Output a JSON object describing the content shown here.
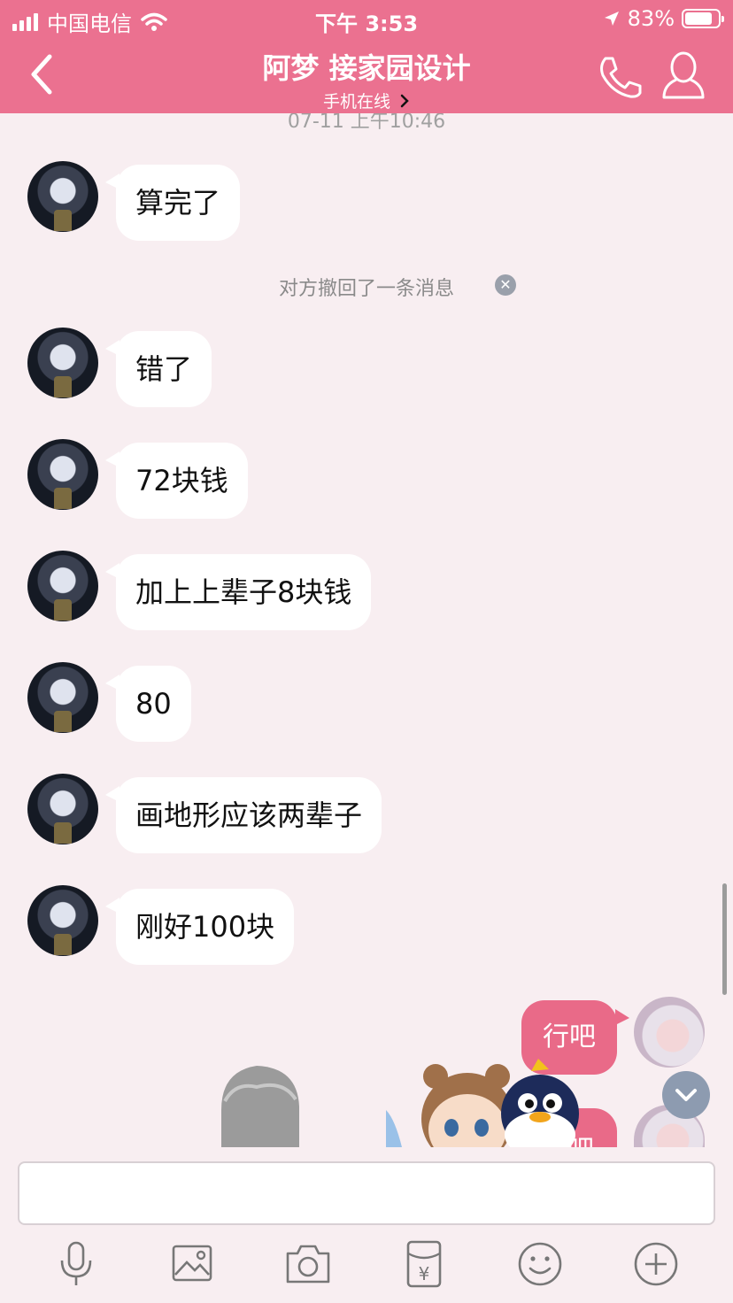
{
  "status_bar": {
    "carrier": "中国电信",
    "time": "下午 3:53",
    "battery": "83%",
    "battery_level": 0.83,
    "icons": [
      "signal-icon",
      "wifi-icon",
      "location-arrow-icon",
      "battery-icon"
    ]
  },
  "header": {
    "title": "阿梦 接家园设计",
    "subtitle": "手机在线",
    "icons": [
      "back-chevron-icon",
      "phone-icon",
      "profile-icon",
      "chevron-right-icon"
    ]
  },
  "chat": {
    "timestamp": "07-11 上午10:46",
    "recall_notice": "对方撤回了一条消息",
    "messages_in": [
      {
        "text": "算完了"
      },
      {
        "text": "错了"
      },
      {
        "text": "72块钱"
      },
      {
        "text": "加上上辈子8块钱"
      },
      {
        "text": "80"
      },
      {
        "text": "画地形应该两辈子"
      },
      {
        "text": "刚好100块"
      }
    ],
    "messages_out": [
      {
        "text": "行吧"
      },
      {
        "text": "吧"
      }
    ]
  },
  "toolbar": {
    "items": [
      "microphone-icon",
      "image-icon",
      "camera-icon",
      "red-packet-icon",
      "emoji-icon",
      "plus-icon"
    ]
  },
  "colors": {
    "brand": "#eb7190",
    "my_bubble": "#e96a88",
    "background": "#f8eef1"
  }
}
